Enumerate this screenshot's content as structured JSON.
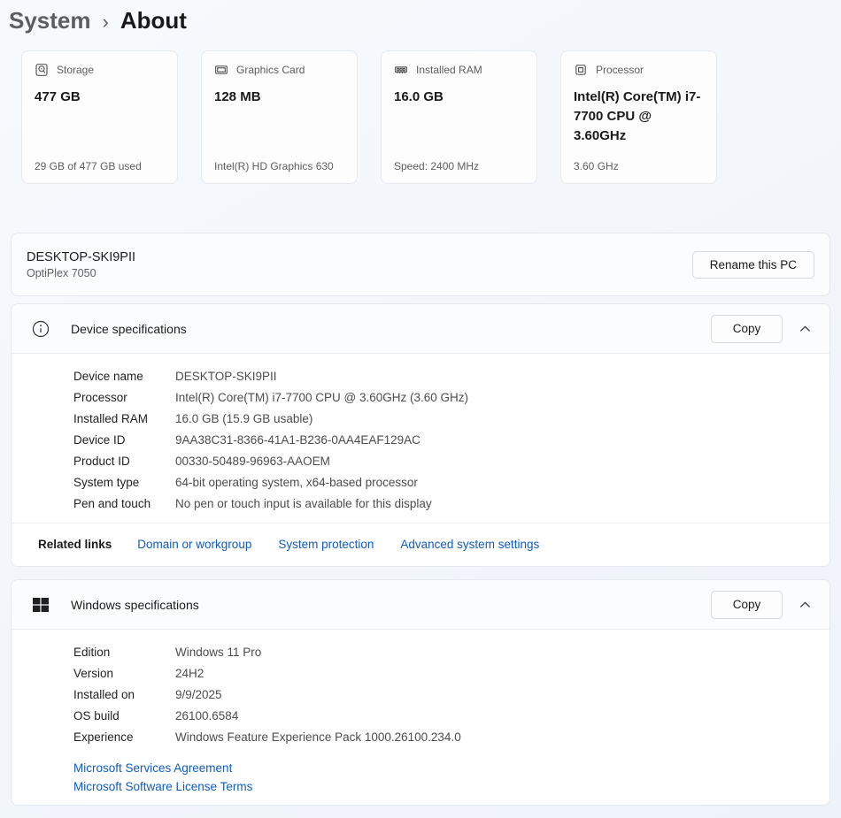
{
  "breadcrumb": {
    "parent": "System",
    "separator": "›",
    "current": "About"
  },
  "cards": [
    {
      "icon": "storage-icon",
      "label": "Storage",
      "value": "477 GB",
      "caption": "29 GB of 477 GB used"
    },
    {
      "icon": "graphics-card-icon",
      "label": "Graphics Card",
      "value": "128 MB",
      "caption": "Intel(R) HD Graphics 630"
    },
    {
      "icon": "ram-icon",
      "label": "Installed RAM",
      "value": "16.0 GB",
      "caption": "Speed: 2400 MHz"
    },
    {
      "icon": "processor-icon",
      "label": "Processor",
      "value": "Intel(R) Core(TM) i7-7700 CPU @ 3.60GHz",
      "caption": "3.60 GHz"
    }
  ],
  "device_panel": {
    "name": "DESKTOP-SKI9PII",
    "model": "OptiPlex 7050",
    "rename_button": "Rename this PC"
  },
  "device_specs": {
    "title": "Device specifications",
    "copy_button": "Copy",
    "rows": [
      {
        "label": "Device name",
        "value": "DESKTOP-SKI9PII"
      },
      {
        "label": "Processor",
        "value": "Intel(R) Core(TM) i7-7700 CPU @ 3.60GHz (3.60 GHz)"
      },
      {
        "label": "Installed RAM",
        "value": "16.0 GB (15.9 GB usable)"
      },
      {
        "label": "Device ID",
        "value": "9AA38C31-8366-41A1-B236-0AA4EAF129AC"
      },
      {
        "label": "Product ID",
        "value": "00330-50489-96963-AAOEM"
      },
      {
        "label": "System type",
        "value": "64-bit operating system, x64-based processor"
      },
      {
        "label": "Pen and touch",
        "value": "No pen or touch input is available for this display"
      }
    ],
    "related_links_label": "Related links",
    "related_links": [
      "Domain or workgroup",
      "System protection",
      "Advanced system settings"
    ]
  },
  "windows_specs": {
    "title": "Windows specifications",
    "copy_button": "Copy",
    "rows": [
      {
        "label": "Edition",
        "value": "Windows 11 Pro"
      },
      {
        "label": "Version",
        "value": "24H2"
      },
      {
        "label": "Installed on",
        "value": "9/9/2025"
      },
      {
        "label": "OS build",
        "value": "26100.6584"
      },
      {
        "label": "Experience",
        "value": "Windows Feature Experience Pack 1000.26100.234.0"
      }
    ],
    "links": [
      "Microsoft Services Agreement",
      "Microsoft Software License Terms"
    ]
  },
  "colors": {
    "link": "#0f5cbd",
    "accent": "#005fb8",
    "card_background": "#fdfdfe",
    "page_background": "#f2f6fb"
  }
}
